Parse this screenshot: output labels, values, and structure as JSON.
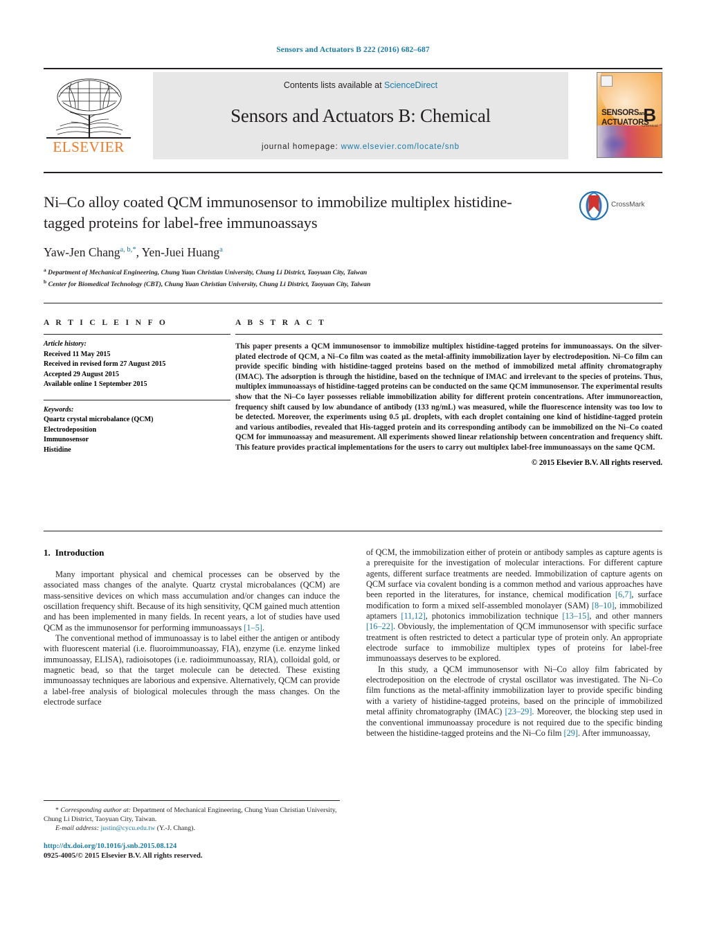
{
  "running_head": "Sensors and Actuators B 222 (2016) 682–687",
  "masthead": {
    "contents_prefix": "Contents lists available at ",
    "sciencedirect": "ScienceDirect",
    "journal_title": "Sensors and Actuators B: Chemical",
    "homepage_label": "journal homepage:",
    "homepage_url": "www.elsevier.com/locate/snb",
    "publisher_wordmark": "ELSEVIER",
    "publisher_logo_icon": "elsevier-tree-icon",
    "cover_line1": "SENSORS",
    "cover_and": "and",
    "cover_line2": "ACTUATORS",
    "cover_letter": "B",
    "cover_sub": "Chemical",
    "accent_blue": "#1a7ba6",
    "elsevier_orange": "#f47721"
  },
  "article": {
    "title": "Ni–Co alloy coated QCM immunosensor to immobilize multiplex histidine-tagged proteins for label-free immunoassays",
    "crossmark_label": "CrossMark",
    "crossmark_icon": "crossmark-logo-icon",
    "authors_html": "Yaw-Jen Chang<sup>a, b,</sup><sup>*</sup>, Yen-Juei Huang<sup>a</sup>",
    "affiliations": [
      {
        "marker": "a",
        "text": "Department of Mechanical Engineering, Chung Yuan Christian University, Chung Li District, Taoyuan City, Taiwan"
      },
      {
        "marker": "b",
        "text": "Center for Biomedical Technology (CBT), Chung Yuan Christian University, Chung Li District, Taoyuan City, Taiwan"
      }
    ]
  },
  "article_info": {
    "heading": "A R T I C L E   I N F O",
    "history_label": "Article history:",
    "history": [
      "Received 11 May 2015",
      "Received in revised form 27 August 2015",
      "Accepted 29 August 2015",
      "Available online 1 September 2015"
    ],
    "keywords_label": "Keywords:",
    "keywords": [
      "Quartz crystal microbalance (QCM)",
      "Electrodeposition",
      "Immunosensor",
      "Histidine"
    ]
  },
  "abstract": {
    "heading": "A B S T R A C T",
    "text": "This paper presents a QCM immunosensor to immobilize multiplex histidine-tagged proteins for immunoassays. On the silver-plated electrode of QCM, a Ni–Co film was coated as the metal-affinity immobilization layer by electrodeposition. Ni–Co film can provide specific binding with histidine-tagged proteins based on the method of immobilized metal affinity chromatography (IMAC). The adsorption is through the histidine, based on the technique of IMAC and irrelevant to the species of proteins. Thus, multiplex immunoassays of histidine-tagged proteins can be conducted on the same QCM immunosensor. The experimental results show that the Ni–Co layer possesses reliable immobilization ability for different protein concentrations. After immunoreaction, frequency shift caused by low abundance of antibody (133 ng/mL) was measured, while the fluorescence intensity was too low to be detected. Moreover, the experiments using 0.5 µL droplets, with each droplet containing one kind of histidine-tagged protein and various antibodies, revealed that His-tagged protein and its corresponding antibody can be immobilized on the Ni–Co coated QCM for immunoassay and measurement. All experiments showed linear relationship between concentration and frequency shift. This feature provides practical implementations for the users to carry out multiplex label-free immunoassays on the same QCM.",
    "copyright": "© 2015 Elsevier B.V. All rights reserved."
  },
  "body": {
    "section_number": "1.",
    "section_title": "Introduction",
    "left_paragraphs": [
      "Many important physical and chemical processes can be observed by the associated mass changes of the analyte. Quartz crystal microbalances (QCM) are mass-sensitive devices on which mass accumulation and/or changes can induce the oscillation frequency shift. Because of its high sensitivity, QCM gained much attention and has been implemented in many fields. In recent years, a lot of studies have used QCM as the immunosensor for performing immunoassays [1–5].",
      "The conventional method of immunoassay is to label either the antigen or antibody with fluorescent material (i.e. fluoroimmunoassay, FIA), enzyme (i.e. enzyme linked immunoassay, ELISA), radioisotopes (i.e. radioimmunoassay, RIA), colloidal gold, or magnetic bead, so that the target molecule can be detected. These existing immunoassay techniques are laborious and expensive. Alternatively, QCM can provide a label-free analysis of biological molecules through the mass changes. On the electrode surface"
    ],
    "right_paragraphs": [
      "of QCM, the immobilization either of protein or antibody samples as capture agents is a prerequisite for the investigation of molecular interactions. For different capture agents, different surface treatments are needed. Immobilization of capture agents on QCM surface via covalent bonding is a common method and various approaches have been reported in the literatures, for instance, chemical modification [6,7], surface modification to form a mixed self-assembled monolayer (SAM) [8–10], immobilized aptamers [11,12], photonics immobilization technique [13–15], and other manners [16–22]. Obviously, the implementation of QCM immunosensor with specific surface treatment is often restricted to detect a particular type of protein only. An appropriate electrode surface to immobilize multiplex types of proteins for label-free immunoassays deserves to be explored.",
      "In this study, a QCM immunosensor with Ni–Co alloy film fabricated by electrodeposition on the electrode of crystal oscillator was investigated. The Ni–Co film functions as the metal-affinity immobilization layer to provide specific binding with a variety of histidine-tagged proteins, based on the principle of immobilized metal affinity chromatography (IMAC) [23–29]. Moreover, the blocking step used in the conventional immunoassay procedure is not required due to the specific binding between the histidine-tagged proteins and the Ni–Co film [29]. After immunoassay,"
    ],
    "references_inline": [
      "[1–5]",
      "[6,7]",
      "[8–10]",
      "[11,12]",
      "[13–15]",
      "[16–22]",
      "[23–29]",
      "[29]"
    ]
  },
  "footnotes": {
    "corresponding_marker": "*",
    "corresponding_label": "Corresponding author at:",
    "corresponding_text": "Department of Mechanical Engineering, Chung Yuan Christian University, Chung Li District, Taoyuan City, Taiwan.",
    "email_label": "E-mail address:",
    "email": "justin@cycu.edu.tw",
    "email_suffix": "(Y.-J. Chang)."
  },
  "imprint": {
    "doi": "http://dx.doi.org/10.1016/j.snb.2015.08.124",
    "issn_line": "0925-4005/© 2015 Elsevier B.V. All rights reserved."
  }
}
